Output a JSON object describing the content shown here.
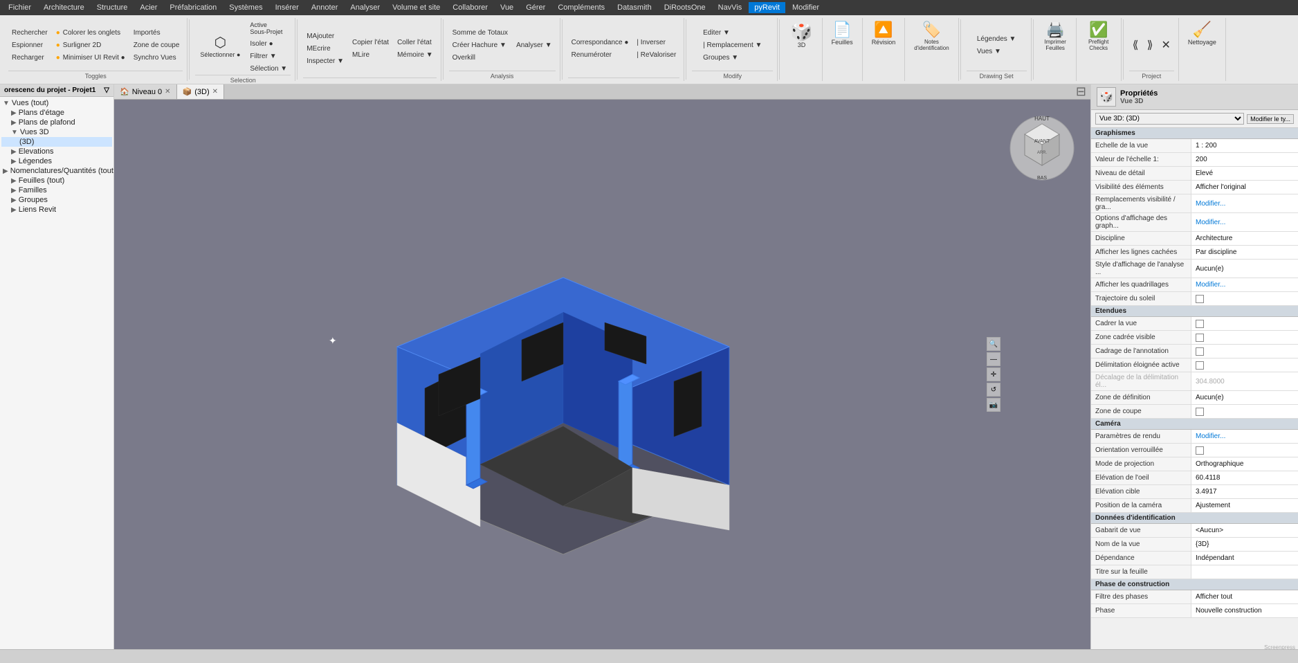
{
  "menubar": {
    "items": [
      "Fichier",
      "Architecture",
      "Structure",
      "Acier",
      "Préfabrication",
      "Systèmes",
      "Insérer",
      "Annoter",
      "Analyser",
      "Volume et site",
      "Collaborer",
      "Vue",
      "Gérer",
      "Compléments",
      "Datasmith",
      "DiRootsOne",
      "NavVis",
      "pyRevit",
      "Modifier"
    ],
    "active": "pyRevit",
    "extra": "☰"
  },
  "ribbon": {
    "groups": [
      {
        "id": "quick",
        "buttons_col1": [
          "Rechercher",
          "Espionner",
          "Recharger"
        ],
        "buttons_col2": [
          "Colorer les onglets",
          "Surligner 2D",
          "Minimiser UI Revit ●"
        ],
        "buttons_col3": [
          "Importés",
          "Zone de coupe",
          "Synchro Vues"
        ],
        "title": "Toggles"
      },
      {
        "id": "selection",
        "main_btn": "Sélectionner ●",
        "sub_btn": "Active\nSous-Projet",
        "sub_items": [
          "Isoler ●",
          "Filtrer ▼",
          "Sélection ▼"
        ],
        "title": "Selection"
      },
      {
        "id": "modify_group",
        "items": [
          "MAjouter",
          "Copier l'état",
          "Coller l'état",
          "Mémoire ▼"
        ],
        "items2": [
          "MEcrire",
          "MLire"
        ],
        "items3": [
          "Inspecter ▼"
        ],
        "title": ""
      },
      {
        "id": "analysis",
        "items": [
          "Somme de Totaux",
          "Analyser ▼"
        ],
        "title": "Analysis"
      },
      {
        "id": "correspondance",
        "items": [
          "Correspondance ●",
          "Inverser",
          "Renumeroter",
          "ReValoriser"
        ],
        "title": ""
      },
      {
        "id": "edit",
        "items": [
          "Editer ▼",
          "Remplacement ▼",
          "Groupes ▼"
        ],
        "title": "Modify"
      },
      {
        "id": "view3d",
        "label": "3D",
        "title": ""
      },
      {
        "id": "sheets",
        "label": "Feuilles",
        "title": ""
      },
      {
        "id": "revision",
        "label": "Révision",
        "title": ""
      },
      {
        "id": "notes",
        "label": "Notes\nd'identification",
        "title": ""
      },
      {
        "id": "views_grp",
        "items": [
          "Légendes ▼",
          "Vues ▼"
        ],
        "title": "Drawing Set"
      },
      {
        "id": "print",
        "label": "Imprimer\nFeuilles",
        "title": ""
      },
      {
        "id": "preflight",
        "label": "Preflight\nChecks",
        "title": ""
      },
      {
        "id": "project",
        "items": [
          "⟪",
          "⟫",
          "✕"
        ],
        "title": "Project"
      },
      {
        "id": "nettoyage",
        "label": "Nettoyage",
        "title": ""
      }
    ]
  },
  "project_title": "orescenc du projet - Projet1",
  "views": {
    "tabs": [
      {
        "label": "Niveau 0",
        "icon": "🏠",
        "active": false,
        "closeable": true
      },
      {
        "label": "(3D)",
        "icon": "📦",
        "active": true,
        "closeable": true
      }
    ]
  },
  "tree": {
    "title": "orescenc du projet - Projet1",
    "items": [
      {
        "level": 0,
        "label": "Vues (tout)",
        "icon": "▼"
      },
      {
        "level": 1,
        "label": "Plans d'étage",
        "icon": "▶"
      },
      {
        "level": 1,
        "label": "Plans de plafond",
        "icon": "▶"
      },
      {
        "level": 1,
        "label": "Vues 3D",
        "icon": "▼"
      },
      {
        "level": 2,
        "label": "(3D)",
        "icon": "",
        "selected": true
      },
      {
        "level": 1,
        "label": "Elevations",
        "icon": "▶"
      },
      {
        "level": 1,
        "label": "Légendes",
        "icon": "▶"
      },
      {
        "level": 1,
        "label": "Nomenclatures/Quantités (tout)",
        "icon": "▶"
      },
      {
        "level": 1,
        "label": "Feuilles (tout)",
        "icon": "▶"
      },
      {
        "level": 1,
        "label": "Familles",
        "icon": "▶"
      },
      {
        "level": 1,
        "label": "Groupes",
        "icon": "▶"
      },
      {
        "level": 1,
        "label": "Liens Revit",
        "icon": "▶"
      }
    ]
  },
  "properties": {
    "title": "Propriétés",
    "view_type": "Vue 3D",
    "view_name_label": "Vue 3D: (3D)",
    "modify_btn": "Modifier le ty...",
    "sections": [
      {
        "name": "Graphismes",
        "rows": [
          {
            "label": "Echelle de la vue",
            "value": "1 : 200"
          },
          {
            "label": "Valeur de l'échelle  1:",
            "value": "200"
          },
          {
            "label": "Niveau de détail",
            "value": "Elevé"
          },
          {
            "label": "Visibilité des éléments",
            "value": "Afficher l'original"
          },
          {
            "label": "Remplacements visibilité / gra...",
            "value": "Modifier..."
          },
          {
            "label": "Options d'affichage des graph...",
            "value": "Modifier..."
          },
          {
            "label": "Discipline",
            "value": "Architecture"
          },
          {
            "label": "Afficher les lignes cachées",
            "value": "Par discipline"
          },
          {
            "label": "Style d'affichage de l'analyse ...",
            "value": "Aucun(e)"
          },
          {
            "label": "Afficher les quadrillages",
            "value": "Modifier..."
          },
          {
            "label": "Trajectoire du soleil",
            "value": "",
            "checkbox": true
          }
        ]
      },
      {
        "name": "Etendues",
        "rows": [
          {
            "label": "Cadrer la vue",
            "value": "",
            "checkbox": true
          },
          {
            "label": "Zone cadrée visible",
            "value": "",
            "checkbox": true
          },
          {
            "label": "Cadrage de l'annotation",
            "value": "",
            "checkbox": true
          },
          {
            "label": "Délimitation éloignée active",
            "value": "",
            "checkbox": true
          },
          {
            "label": "Décalage de la délimitation él...",
            "value": "304.8000"
          },
          {
            "label": "Zone de définition",
            "value": "Aucun(e)"
          },
          {
            "label": "Zone de coupe",
            "value": "",
            "checkbox": true
          }
        ]
      },
      {
        "name": "Caméra",
        "rows": [
          {
            "label": "Paramètres de rendu",
            "value": "Modifier..."
          },
          {
            "label": "Orientation verrouillée",
            "value": "",
            "checkbox": true
          },
          {
            "label": "Mode de projection",
            "value": "Orthographique"
          },
          {
            "label": "Elévation de l'oeil",
            "value": "60.4118"
          },
          {
            "label": "Elévation cible",
            "value": "3.4917"
          },
          {
            "label": "Position de la caméra",
            "value": "Ajustement"
          }
        ]
      },
      {
        "name": "Données d'identification",
        "rows": [
          {
            "label": "Gabarit de vue",
            "value": "<Aucun>"
          },
          {
            "label": "Nom de la vue",
            "value": "{3D}"
          },
          {
            "label": "Dépendance",
            "value": "Indépendant"
          },
          {
            "label": "Titre sur la feuille",
            "value": ""
          }
        ]
      },
      {
        "name": "Phase de construction",
        "rows": [
          {
            "label": "Filtre des phases",
            "value": "Afficher tout"
          },
          {
            "label": "Phase",
            "value": "Nouvelle construction"
          }
        ]
      }
    ]
  },
  "status_bar": {
    "text": ""
  },
  "colors": {
    "accent_blue": "#0060cc",
    "ribbon_bg": "#e8e8e8",
    "tab_active": "#f0f0f0",
    "building_blue": "#3060c8",
    "building_dark": "#404040",
    "building_floor": "#c8c8c8"
  }
}
